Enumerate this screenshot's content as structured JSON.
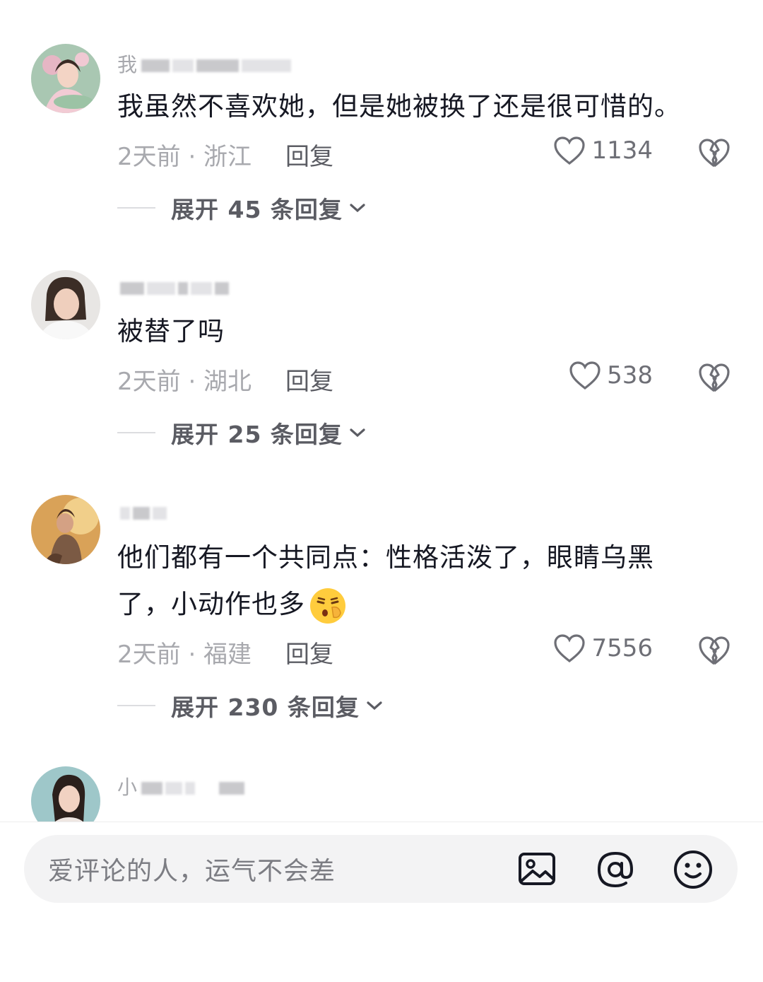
{
  "comments": [
    {
      "username": "我",
      "text": "我虽然不喜欢她，但是她被换了还是很可惜的。",
      "time_location": "2天前 · 浙江",
      "reply_label": "回复",
      "likes": "1134",
      "expand_label": "展开 45 条回复"
    },
    {
      "username": "",
      "text": "被替了吗",
      "time_location": "2天前 · 湖北",
      "reply_label": "回复",
      "likes": "538",
      "expand_label": "展开 25 条回复"
    },
    {
      "username": "",
      "text_line1": "他们都有一个共同点：性格活泼了，眼睛乌黑",
      "text_line2": "了，小动作也多",
      "emoji": "shushing-face-emoji",
      "time_location": "2天前 · 福建",
      "reply_label": "回复",
      "likes": "7556",
      "expand_label": "展开 230 条回复"
    },
    {
      "username": "小"
    }
  ],
  "input": {
    "placeholder": "爱评论的人，运气不会差"
  },
  "icons": {
    "like": "heart-outline-icon",
    "dislike": "broken-heart-icon",
    "expand": "chevron-down-icon",
    "image": "image-icon",
    "mention": "at-icon",
    "emoji": "smiley-icon"
  },
  "colors": {
    "text": "#161823",
    "meta": "#a8a9ae",
    "reply": "#5b5c63",
    "input_bg": "#f3f3f4"
  }
}
